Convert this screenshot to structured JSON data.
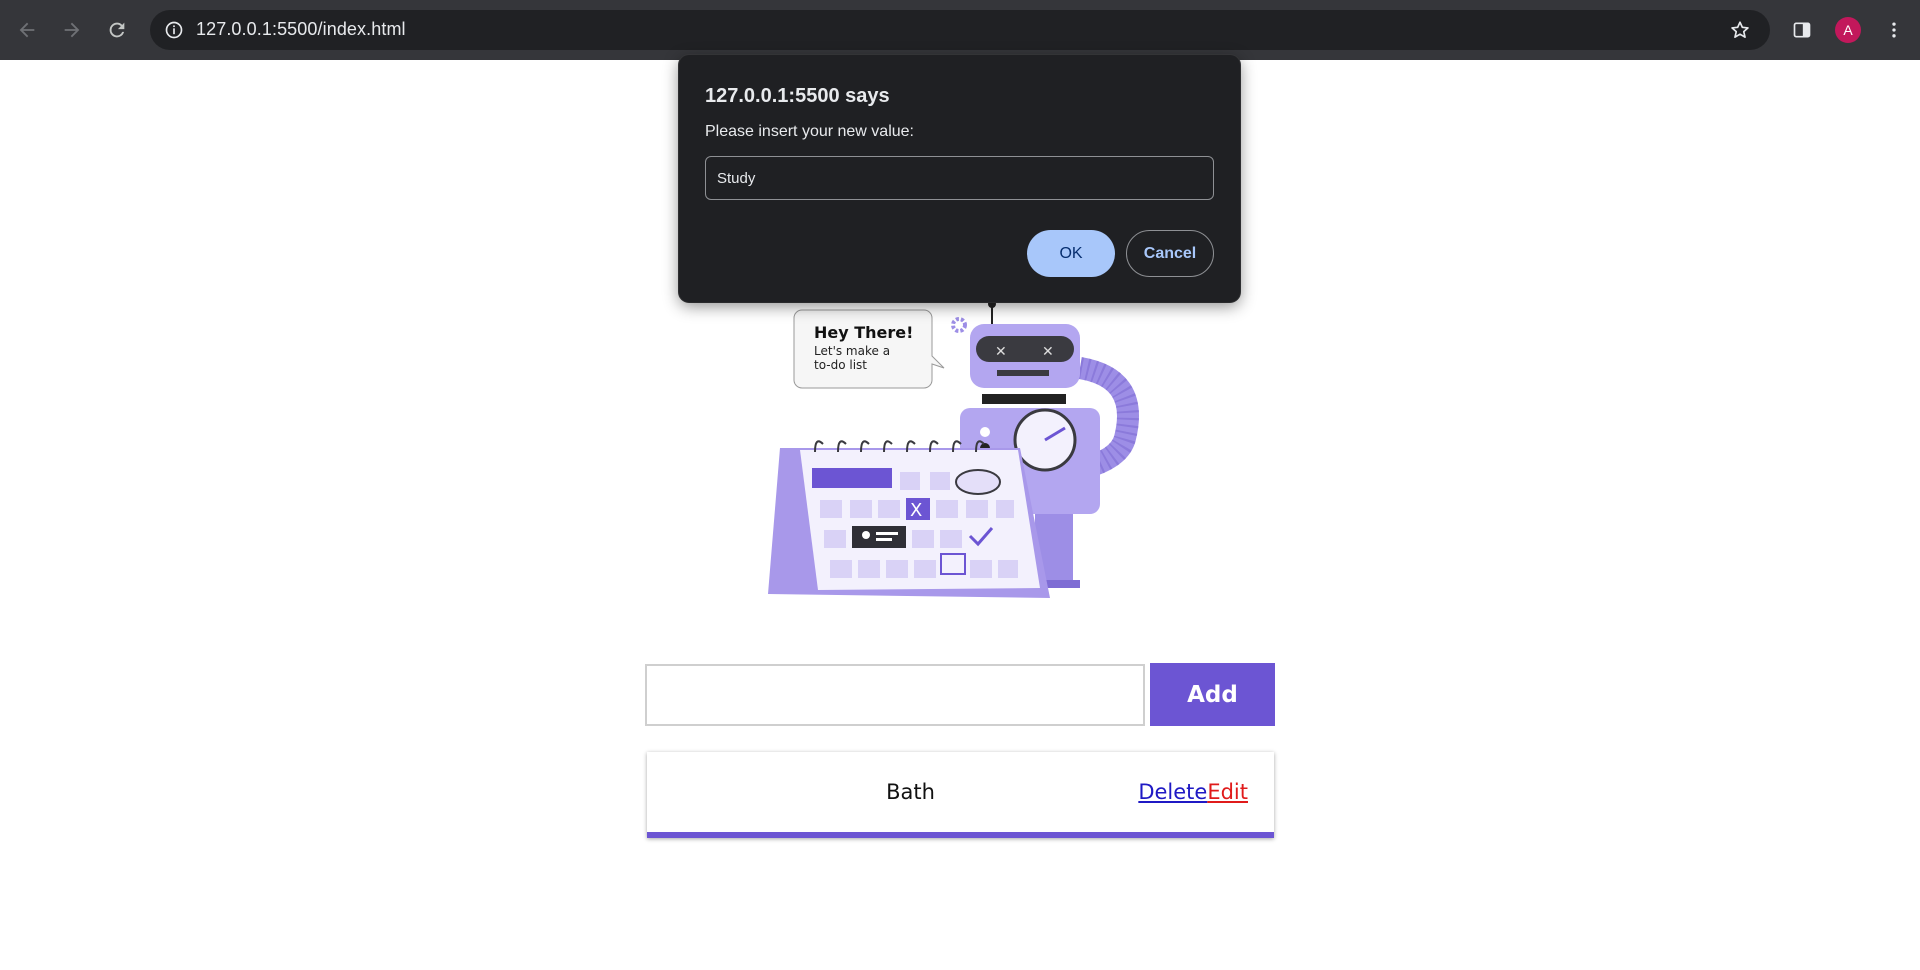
{
  "browser": {
    "url": "127.0.0.1:5500/index.html",
    "profile_initial": "A",
    "icons": [
      "back-arrow-icon",
      "forward-arrow-icon",
      "reload-icon",
      "info-icon",
      "star-icon",
      "side-panel-icon",
      "more-vert-icon"
    ],
    "colors": {
      "toolbar": "#35363a",
      "omnibox": "#202124",
      "avatar": "#c2185b"
    }
  },
  "dialog": {
    "title": "127.0.0.1:5500 says",
    "message": "Please insert your new value:",
    "input_value": "Study",
    "ok_label": "OK",
    "cancel_label": "Cancel"
  },
  "illustration": {
    "bubble_title": "Hey There!",
    "bubble_line1": "Let's make a",
    "bubble_line2": "to-do list"
  },
  "todo": {
    "input_value": "",
    "add_label": "Add",
    "items": [
      {
        "text": "Bath",
        "delete_label": "Delete",
        "edit_label": "Edit"
      }
    ],
    "accent_color": "#6c55d3"
  }
}
